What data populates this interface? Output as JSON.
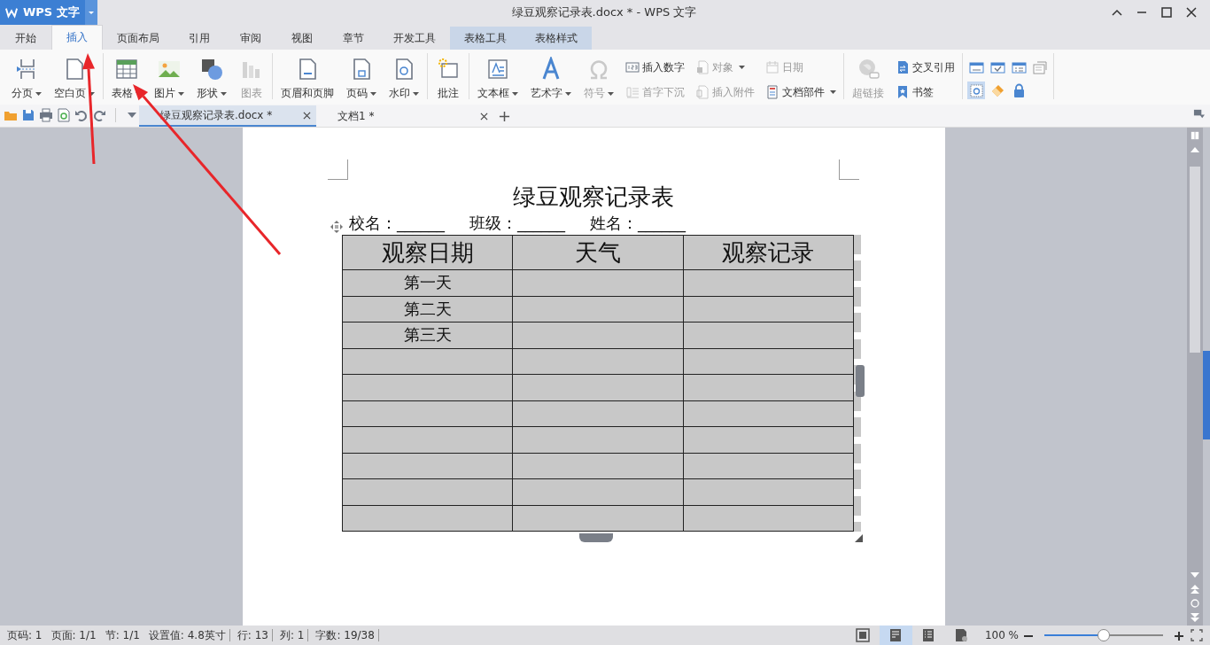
{
  "app_button": {
    "label": "WPS 文字"
  },
  "window": {
    "title": "绿豆观察记录表.docx * - WPS 文字"
  },
  "tabs": [
    {
      "label": "开始",
      "selected": false,
      "contextual": false
    },
    {
      "label": "插入",
      "selected": true,
      "contextual": false
    },
    {
      "label": "页面布局",
      "selected": false,
      "contextual": false
    },
    {
      "label": "引用",
      "selected": false,
      "contextual": false
    },
    {
      "label": "审阅",
      "selected": false,
      "contextual": false
    },
    {
      "label": "视图",
      "selected": false,
      "contextual": false
    },
    {
      "label": "章节",
      "selected": false,
      "contextual": false
    },
    {
      "label": "开发工具",
      "selected": false,
      "contextual": false
    },
    {
      "label": "表格工具",
      "selected": false,
      "contextual": true
    },
    {
      "label": "表格样式",
      "selected": false,
      "contextual": true
    }
  ],
  "ribbon": [
    {
      "items": [
        {
          "kind": "large",
          "label": "分页",
          "dropdown": true,
          "disabled": false
        },
        {
          "kind": "large",
          "label": "空白页",
          "dropdown": true,
          "disabled": false
        }
      ]
    },
    {
      "items": [
        {
          "kind": "large",
          "label": "表格",
          "dropdown": true,
          "disabled": false
        },
        {
          "kind": "large",
          "label": "图片",
          "dropdown": true,
          "disabled": false
        },
        {
          "kind": "large",
          "label": "形状",
          "dropdown": true,
          "disabled": false
        },
        {
          "kind": "large",
          "label": "图表",
          "dropdown": false,
          "disabled": true
        }
      ]
    },
    {
      "items": [
        {
          "kind": "large",
          "label": "页眉和页脚",
          "dropdown": false,
          "disabled": false
        },
        {
          "kind": "large",
          "label": "页码",
          "dropdown": true,
          "disabled": false
        },
        {
          "kind": "large",
          "label": "水印",
          "dropdown": true,
          "disabled": false
        }
      ]
    },
    {
      "items": [
        {
          "kind": "large",
          "label": "批注",
          "dropdown": false,
          "disabled": false
        }
      ]
    },
    {
      "items": [
        {
          "kind": "large",
          "label": "文本框",
          "dropdown": true,
          "disabled": false
        },
        {
          "kind": "large",
          "label": "艺术字",
          "dropdown": true,
          "disabled": false
        },
        {
          "kind": "large",
          "label": "符号",
          "dropdown": true,
          "disabled": true
        },
        {
          "kind": "stack",
          "items": [
            {
              "label": "插入数字",
              "dropdown": false,
              "disabled": false
            },
            {
              "label": "首字下沉",
              "dropdown": false,
              "disabled": true
            }
          ]
        },
        {
          "kind": "stack",
          "items": [
            {
              "label": "对象",
              "dropdown": true,
              "disabled": true
            },
            {
              "label": "插入附件",
              "dropdown": false,
              "disabled": true
            }
          ]
        },
        {
          "kind": "stack",
          "items": [
            {
              "label": "日期",
              "dropdown": false,
              "disabled": true
            },
            {
              "label": "文档部件",
              "dropdown": true,
              "disabled": false
            }
          ]
        }
      ]
    },
    {
      "items": [
        {
          "kind": "large",
          "label": "超链接",
          "dropdown": false,
          "disabled": true
        },
        {
          "kind": "stack",
          "items": [
            {
              "label": "交叉引用",
              "dropdown": false,
              "disabled": false
            },
            {
              "label": "书签",
              "dropdown": false,
              "disabled": false
            }
          ]
        }
      ]
    },
    {
      "items": [
        {
          "kind": "icons",
          "items": [
            {
              "selected": false
            },
            {
              "selected": false
            },
            {
              "selected": false
            },
            {
              "selected": false
            },
            {
              "selected": true
            },
            {
              "selected": false
            },
            {
              "selected": false
            }
          ]
        }
      ]
    }
  ],
  "doc_tabs": [
    {
      "label": "绿豆观察记录表.docx *",
      "selected": true
    },
    {
      "label": "文档1 *",
      "selected": false
    }
  ],
  "document": {
    "title": "绿豆观察记录表",
    "info": [
      "校名：______",
      "班级：______",
      "姓名：______"
    ],
    "table": {
      "columns": [
        "观察日期",
        "天气",
        "观察记录"
      ],
      "rows": [
        {
          "kind": "filled",
          "date": "第一天"
        },
        {
          "kind": "filled",
          "date": "第二天"
        },
        {
          "kind": "filled",
          "date": "第三天"
        },
        {
          "kind": "empty"
        },
        {
          "kind": "empty"
        },
        {
          "kind": "empty"
        },
        {
          "kind": "empty"
        },
        {
          "kind": "empty"
        },
        {
          "kind": "empty"
        },
        {
          "kind": "empty"
        }
      ]
    }
  },
  "status_bar": {
    "fields": [
      "页码: 1",
      "页面: 1/1",
      "节: 1/1",
      "设置值: 4.8英寸",
      "行: 13",
      "列: 1",
      "字数: 19/38"
    ],
    "views": [
      {
        "selected": false
      },
      {
        "selected": true
      },
      {
        "selected": false
      },
      {
        "selected": false
      }
    ],
    "zoom": "100 %",
    "zoom_slider": {
      "level": 0.5
    }
  },
  "annotations": [
    {
      "kind": "arrow"
    },
    {
      "kind": "arrow"
    }
  ]
}
